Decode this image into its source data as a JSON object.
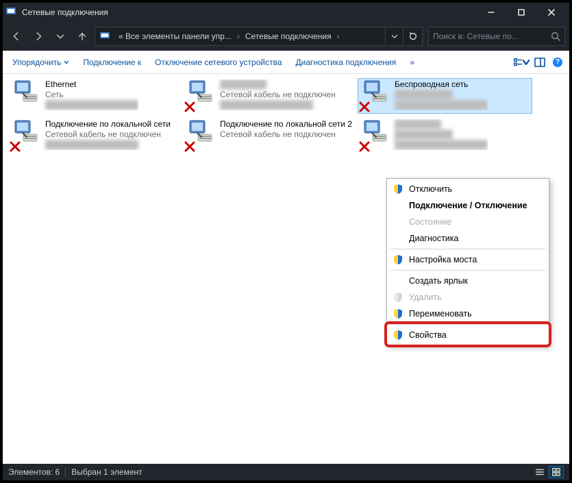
{
  "window": {
    "title": "Сетевые подключения"
  },
  "address": {
    "prefix": "« Все элементы панели упр...",
    "current": "Сетевые подключения"
  },
  "search": {
    "placeholder": "Поиск в: Сетевые по..."
  },
  "toolbar": {
    "organize": "Упорядочить",
    "connect_to": "Подключение к",
    "disable_device": "Отключение сетевого устройства",
    "diagnose": "Диагностика подключения"
  },
  "connections": [
    {
      "name": "Ethernet",
      "line2": "Сеть",
      "line3": "",
      "has_redx": false,
      "blur3": true
    },
    {
      "name": "",
      "line2": "Сетевой кабель не подключен",
      "line3": "",
      "has_redx": true,
      "blur_name": true,
      "blur3": true
    },
    {
      "name": "Беспроводная сеть",
      "line2": "",
      "line3": "",
      "has_redx": true,
      "selected": true,
      "blur2": true,
      "blur3": true
    },
    {
      "name": "Подключение по локальной сети",
      "line2": "Сетевой кабель не подключен",
      "line3": "",
      "has_redx": true,
      "blur3": true
    },
    {
      "name": "Подключение по локальной сети 2",
      "line2": "Сетевой кабель не подключен",
      "line3": "",
      "has_redx": true
    },
    {
      "name": "",
      "line2": "",
      "line3": "",
      "has_redx": true,
      "blur_name": true,
      "blur2": true,
      "blur3": true
    }
  ],
  "context_menu": {
    "items": [
      {
        "label": "Отключить",
        "shield": true
      },
      {
        "label": "Подключение / Отключение",
        "bold": true
      },
      {
        "label": "Состояние",
        "disabled": true
      },
      {
        "label": "Диагностика"
      },
      {
        "sep": true
      },
      {
        "label": "Настройка моста",
        "shield": true
      },
      {
        "sep": true
      },
      {
        "label": "Создать ярлык"
      },
      {
        "label": "Удалить",
        "shield": true,
        "disabled": true
      },
      {
        "label": "Переименовать",
        "shield": true
      },
      {
        "sep": true
      },
      {
        "label": "Свойства",
        "shield": true,
        "highlight": true
      }
    ]
  },
  "statusbar": {
    "count_label": "Элементов: 6",
    "selection_label": "Выбран 1 элемент"
  }
}
